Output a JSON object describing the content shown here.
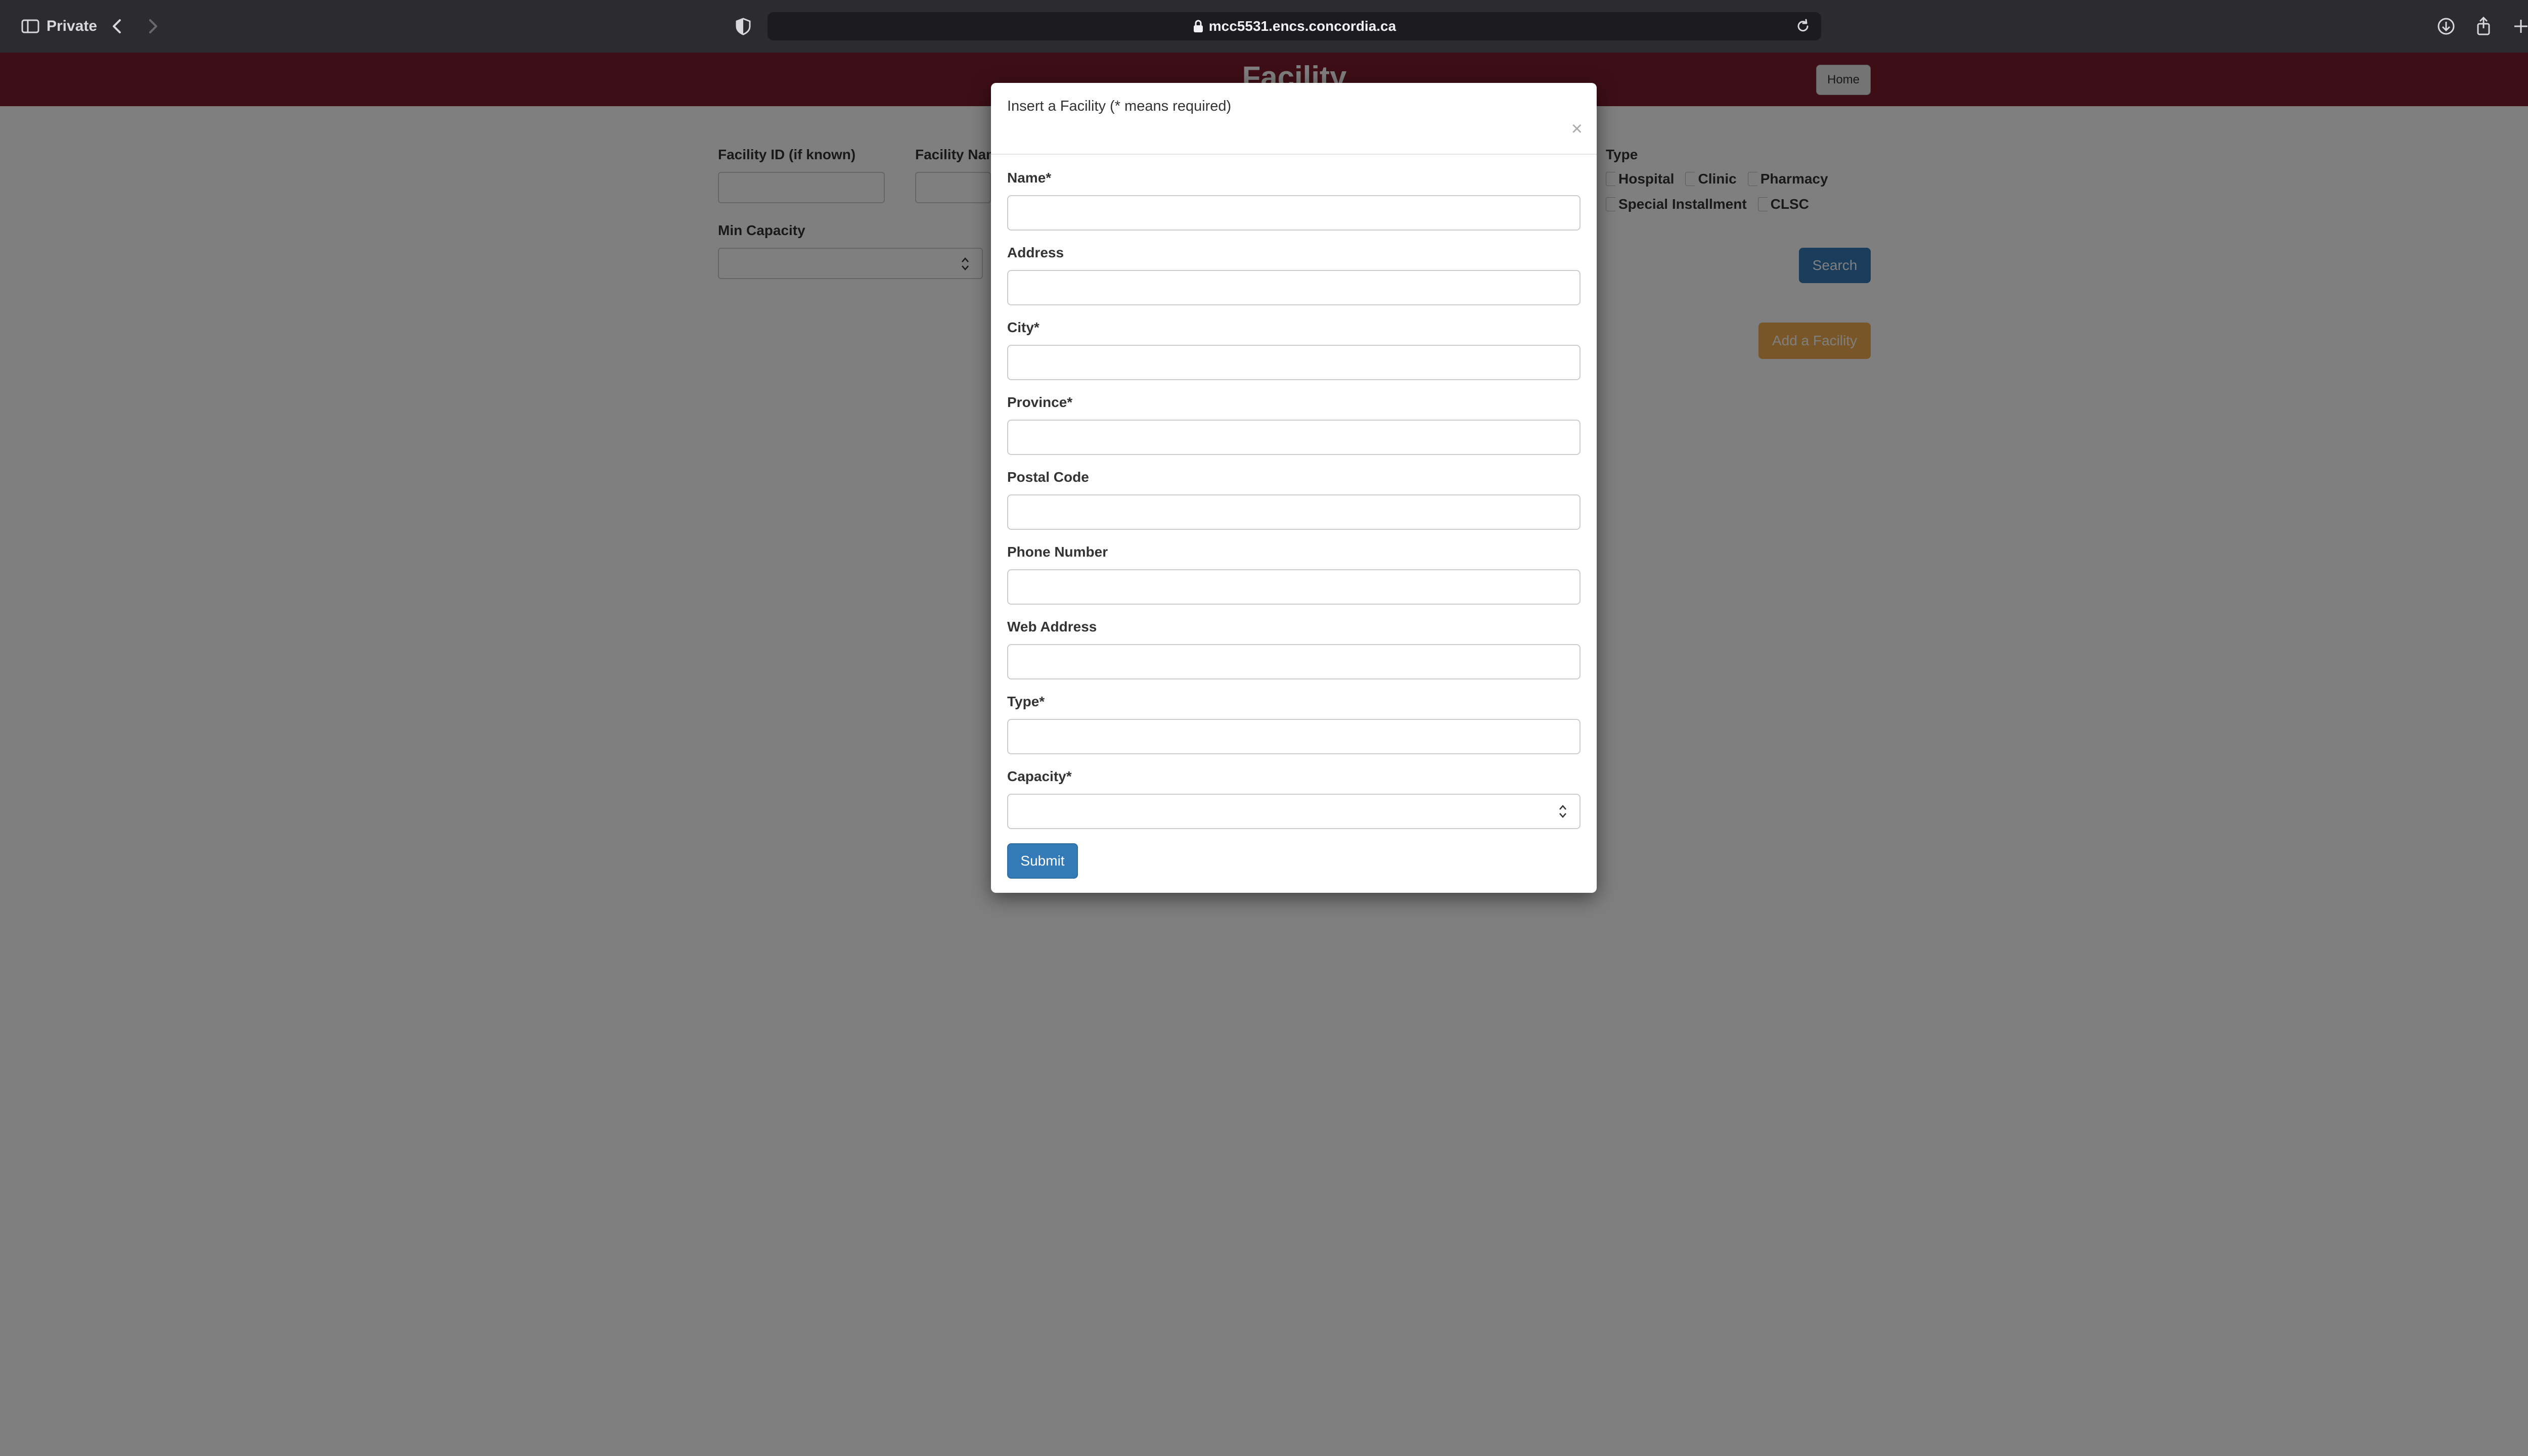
{
  "browser": {
    "private_label": "Private",
    "url": "mcc5531.encs.concordia.ca"
  },
  "page": {
    "header_title": "Facility",
    "home_button": "Home",
    "search_form": {
      "facility_id_label": "Facility ID (if known)",
      "facility_name_label": "Facility Nam",
      "min_capacity_label": "Min Capacity",
      "type_label": "Type",
      "type_options": [
        "Hospital",
        "Clinic",
        "Pharmacy",
        "Special Installment",
        "CLSC"
      ],
      "search_button": "Search"
    },
    "add_button": "Add a Facility"
  },
  "modal": {
    "title": "Insert a Facility (* means required)",
    "close_symbol": "×",
    "fields": [
      {
        "label": "Name*"
      },
      {
        "label": "Address"
      },
      {
        "label": "City*"
      },
      {
        "label": "Province*"
      },
      {
        "label": "Postal Code"
      },
      {
        "label": "Phone Number"
      },
      {
        "label": "Web Address"
      },
      {
        "label": "Type*"
      },
      {
        "label": "Capacity*"
      }
    ],
    "submit_button": "Submit"
  }
}
